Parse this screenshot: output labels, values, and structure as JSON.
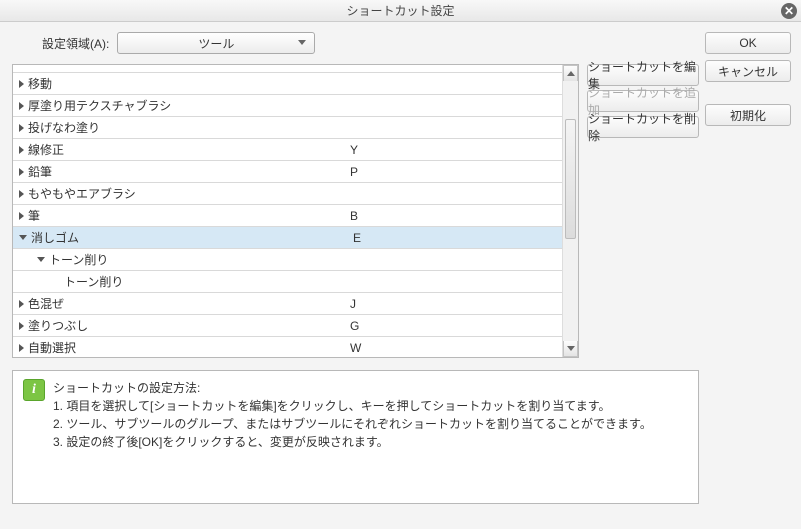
{
  "title": "ショートカット設定",
  "area": {
    "label": "設定領域(A):",
    "value": "ツール"
  },
  "side_buttons": {
    "ok": "OK",
    "cancel": "キャンセル",
    "init": "初期化"
  },
  "action_buttons": {
    "edit": "ショートカットを編集",
    "add": "ショートカットを追加",
    "delete": "ショートカットを削除"
  },
  "rows": [
    {
      "name": "移動",
      "key": "",
      "level": 0,
      "expand": "right"
    },
    {
      "name": "厚塗り用テクスチャブラシ",
      "key": "",
      "level": 0,
      "expand": "right"
    },
    {
      "name": "投げなわ塗り",
      "key": "",
      "level": 0,
      "expand": "right"
    },
    {
      "name": "線修正",
      "key": "Y",
      "level": 0,
      "expand": "right"
    },
    {
      "name": "鉛筆",
      "key": "P",
      "level": 0,
      "expand": "right"
    },
    {
      "name": "もやもやエアブラシ",
      "key": "",
      "level": 0,
      "expand": "right"
    },
    {
      "name": "筆",
      "key": "B",
      "level": 0,
      "expand": "right"
    },
    {
      "name": "消しゴム",
      "key": "E",
      "level": 0,
      "expand": "down",
      "selected": true
    },
    {
      "name": "トーン削り",
      "key": "",
      "level": 1,
      "expand": "down"
    },
    {
      "name": "トーン削り",
      "key": "",
      "level": 2,
      "expand": "none"
    },
    {
      "name": "色混ぜ",
      "key": "J",
      "level": 0,
      "expand": "right"
    },
    {
      "name": "塗りつぶし",
      "key": "G",
      "level": 0,
      "expand": "right"
    },
    {
      "name": "自動選択",
      "key": "W",
      "level": 0,
      "expand": "right"
    }
  ],
  "info": {
    "heading": "ショートカットの設定方法:",
    "line1": "1. 項目を選択して[ショートカットを編集]をクリックし、キーを押してショートカットを割り当てます。",
    "line2": "2. ツール、サブツールのグループ、またはサブツールにそれぞれショートカットを割り当てることができます。",
    "line3": "3. 設定の終了後[OK]をクリックすると、変更が反映されます。"
  }
}
